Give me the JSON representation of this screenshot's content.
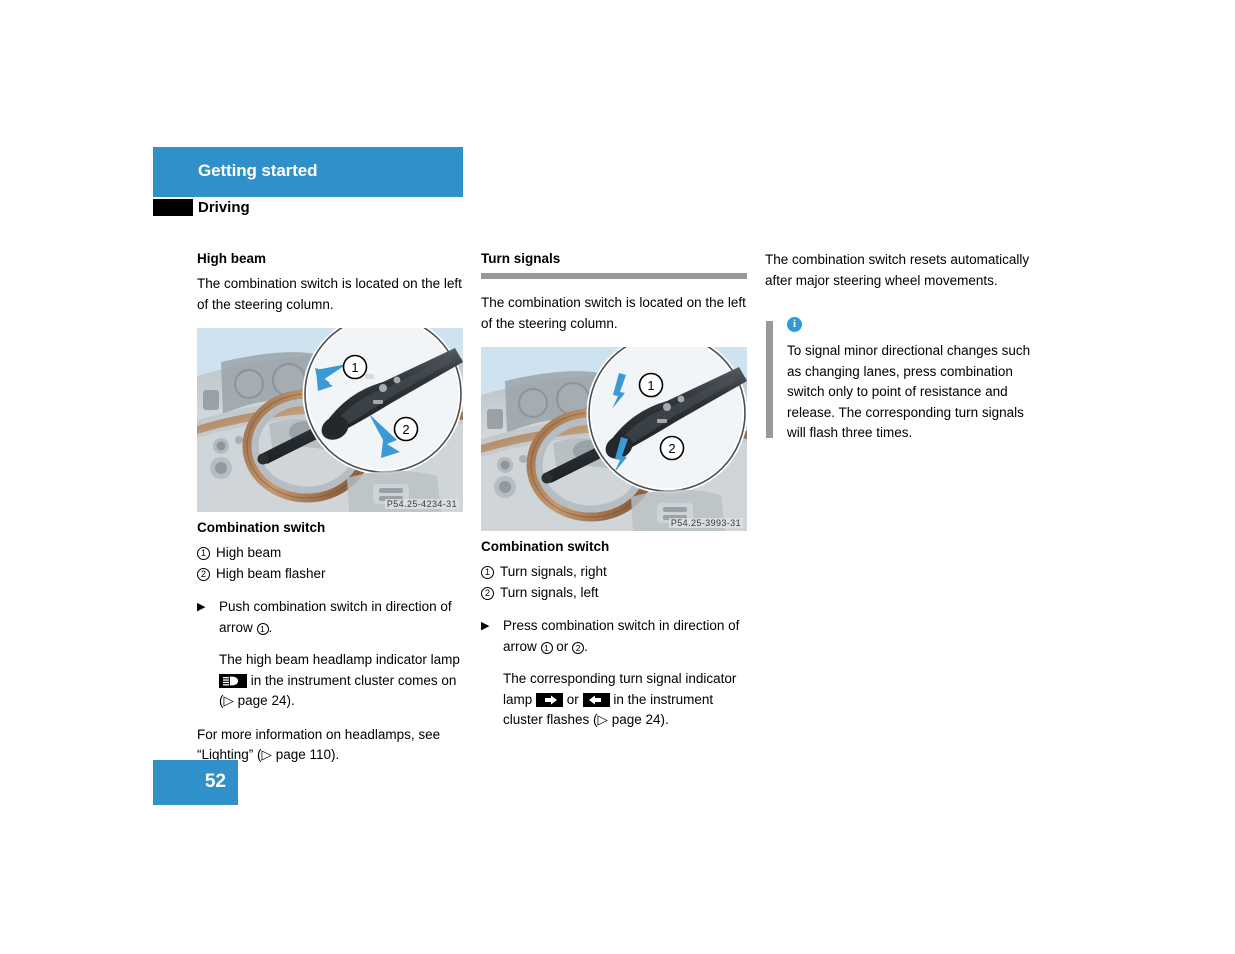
{
  "header": {
    "chapter": "Getting started",
    "section": "Driving",
    "band_color": "#3091ca",
    "marker_color": "#000000"
  },
  "columns": {
    "left": {
      "title": "High beam",
      "intro": "The combination switch is located on the left of the steering column.",
      "figure": {
        "image_id": "P54.25-4234-31",
        "alt_name": "dashboard-steering-column-high-beam-illustration",
        "callouts": [
          "1",
          "2"
        ]
      },
      "figure_label": "Combination switch",
      "legend": [
        {
          "number": "1",
          "label": "High beam"
        },
        {
          "number": "2",
          "label": "High beam flasher"
        }
      ],
      "step": {
        "marker": "▶",
        "text_before": "Push combination switch in direction of arrow",
        "ref": "1",
        "text_after": "."
      },
      "result": {
        "text_before": "The high beam headlamp indicator lamp",
        "icon": "high-beam-indicator-icon",
        "text_middle": "in the instrument cluster comes on (",
        "page_ref_symbol": "▷",
        "page_ref": "page 24",
        "text_after": ")."
      },
      "closing": {
        "text_before": "For more information on headlamps, see “Lighting” (",
        "page_ref_symbol": "▷",
        "page_ref": "page 110",
        "text_after": ")."
      }
    },
    "middle": {
      "title": "Turn signals",
      "rule_color": "#999999",
      "intro": "The combination switch is located on the left of the steering column.",
      "figure": {
        "image_id": "P54.25-3993-31",
        "alt_name": "dashboard-steering-column-turn-signal-illustration",
        "callouts": [
          "1",
          "2"
        ]
      },
      "figure_label": "Combination switch",
      "legend": [
        {
          "number": "1",
          "label": "Turn signals, right"
        },
        {
          "number": "2",
          "label": "Turn signals, left"
        }
      ],
      "step": {
        "marker": "▶",
        "text_before": "Press combination switch in direction of arrow",
        "ref_1": "1",
        "conjunction": "or",
        "ref_2": "2",
        "text_after": "."
      },
      "result": {
        "text_before": "The corresponding turn signal indicator lamp",
        "icon_right": "turn-signal-right-icon",
        "conjunction": "or",
        "icon_left": "turn-signal-left-icon",
        "text_middle": "in the instrument cluster flashes (",
        "page_ref_symbol": "▷",
        "page_ref": "page 24",
        "text_after": ")."
      }
    },
    "right": {
      "intro": "The combination switch resets automatically after major steering wheel movements.",
      "note": {
        "icon": "info-icon",
        "icon_glyph": "i",
        "icon_color": "#2e9bd6",
        "bar_color": "#999999",
        "text": "To signal minor directional changes such as changing lanes, press combination switch only to point of resistance and release. The corresponding turn signals will flash three times."
      }
    }
  },
  "footer": {
    "page_number": "52",
    "box_color": "#3091ca"
  }
}
